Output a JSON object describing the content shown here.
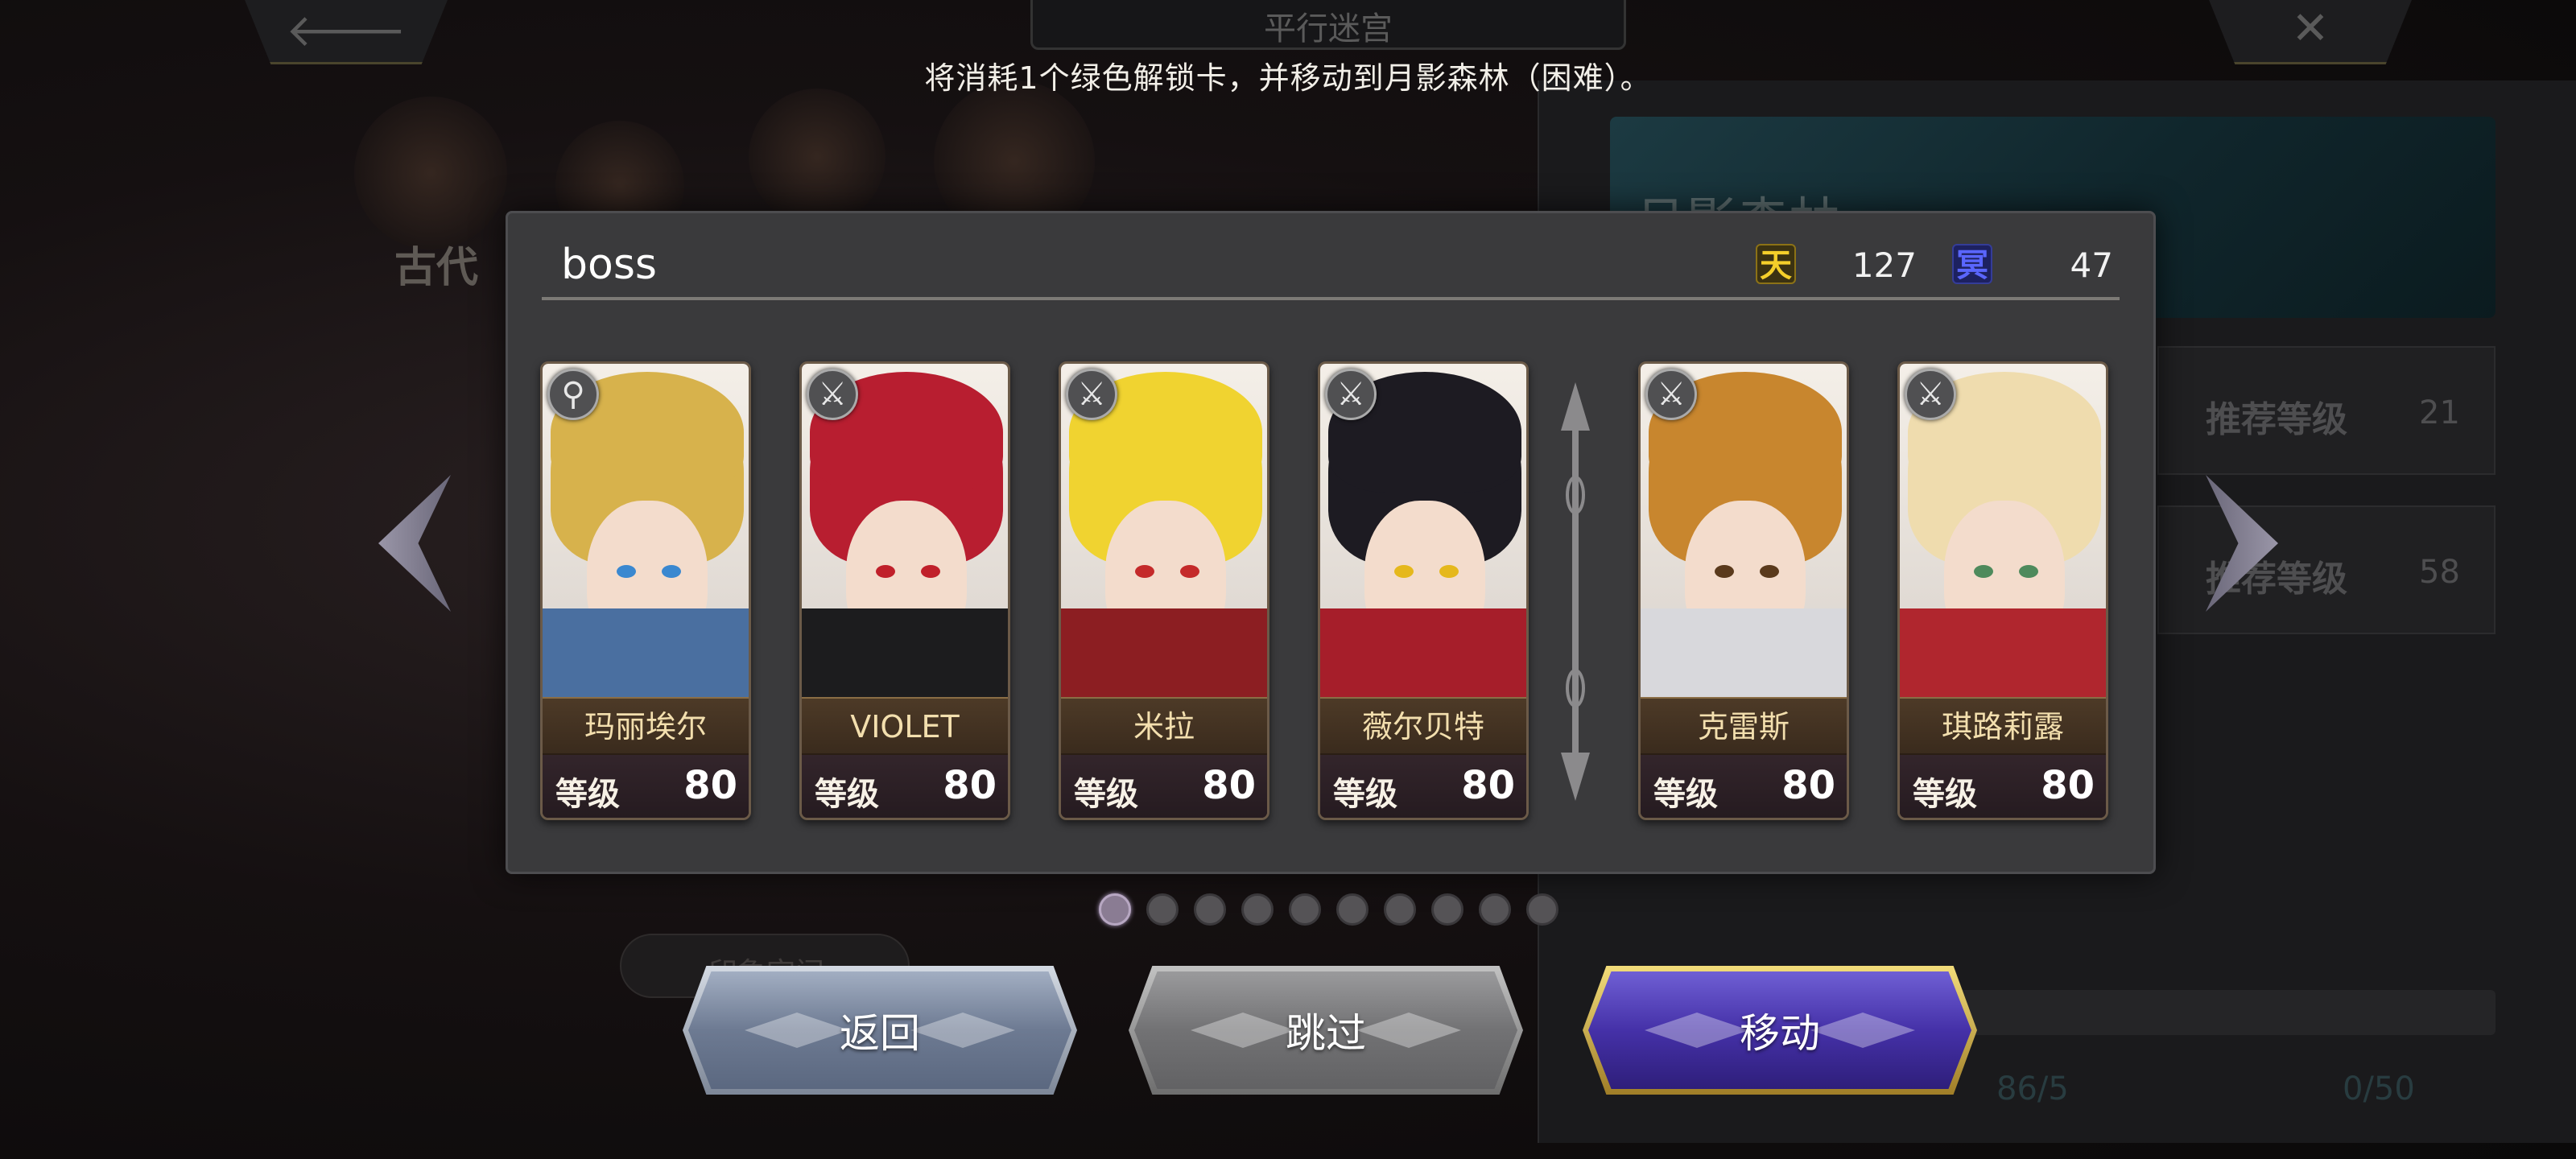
{
  "header": {
    "title": "平行迷宫",
    "back_icon": "arrow-left-icon",
    "close_icon": "close-icon"
  },
  "message": "将消耗1个绿色解锁卡，并移动到月影森林（困难）。",
  "background": {
    "era_label": "古代",
    "stage_title": "月影森林",
    "recommend_rows": [
      {
        "label": "推荐等级",
        "value": "21"
      },
      {
        "label": "推荐等级",
        "value": "58"
      }
    ],
    "pill_text": "印象空间",
    "footer": {
      "stamina": "86/5",
      "tickets": "0/50"
    }
  },
  "party": {
    "name": "boss",
    "currencies": [
      {
        "icon": "tian",
        "glyph": "天",
        "value": "127",
        "color": "#f5cf2a"
      },
      {
        "icon": "ming",
        "glyph": "冥",
        "value": "47",
        "color": "#5a66ff"
      }
    ],
    "level_label": "等级",
    "heroes": [
      {
        "name": "玛丽埃尔",
        "level": "80",
        "class_icon": "staff-icon",
        "class_glyph": "⚲",
        "hair": "#d7b24c",
        "eye": "#3a88d0",
        "cloth": "#4a6fa0"
      },
      {
        "name": "VIOLET",
        "level": "80",
        "class_icon": "sword-icon",
        "class_glyph": "⚔",
        "hair": "#b81e30",
        "eye": "#c0202a",
        "cloth": "#1c1c1e"
      },
      {
        "name": "米拉",
        "level": "80",
        "class_icon": "sword-icon",
        "class_glyph": "⚔",
        "hair": "#f0d330",
        "eye": "#c42a2a",
        "cloth": "#8c1e22"
      },
      {
        "name": "薇尔贝特",
        "level": "80",
        "class_icon": "sword-icon",
        "class_glyph": "⚔",
        "hair": "#1d1b22",
        "eye": "#e5b81c",
        "cloth": "#a61e2a"
      },
      {
        "name": "克雷斯",
        "level": "80",
        "class_icon": "sword-icon",
        "class_glyph": "⚔",
        "hair": "#c8862e",
        "eye": "#5a3a1c",
        "cloth": "#d8d8dc"
      },
      {
        "name": "琪路莉露",
        "level": "80",
        "class_icon": "sword-icon",
        "class_glyph": "⚔",
        "hair": "#efdcae",
        "eye": "#4e8a5c",
        "cloth": "#b0262e"
      }
    ]
  },
  "pagination": {
    "total": 10,
    "active": 0
  },
  "buttons": {
    "back": "返回",
    "skip": "跳过",
    "move": "移动"
  }
}
